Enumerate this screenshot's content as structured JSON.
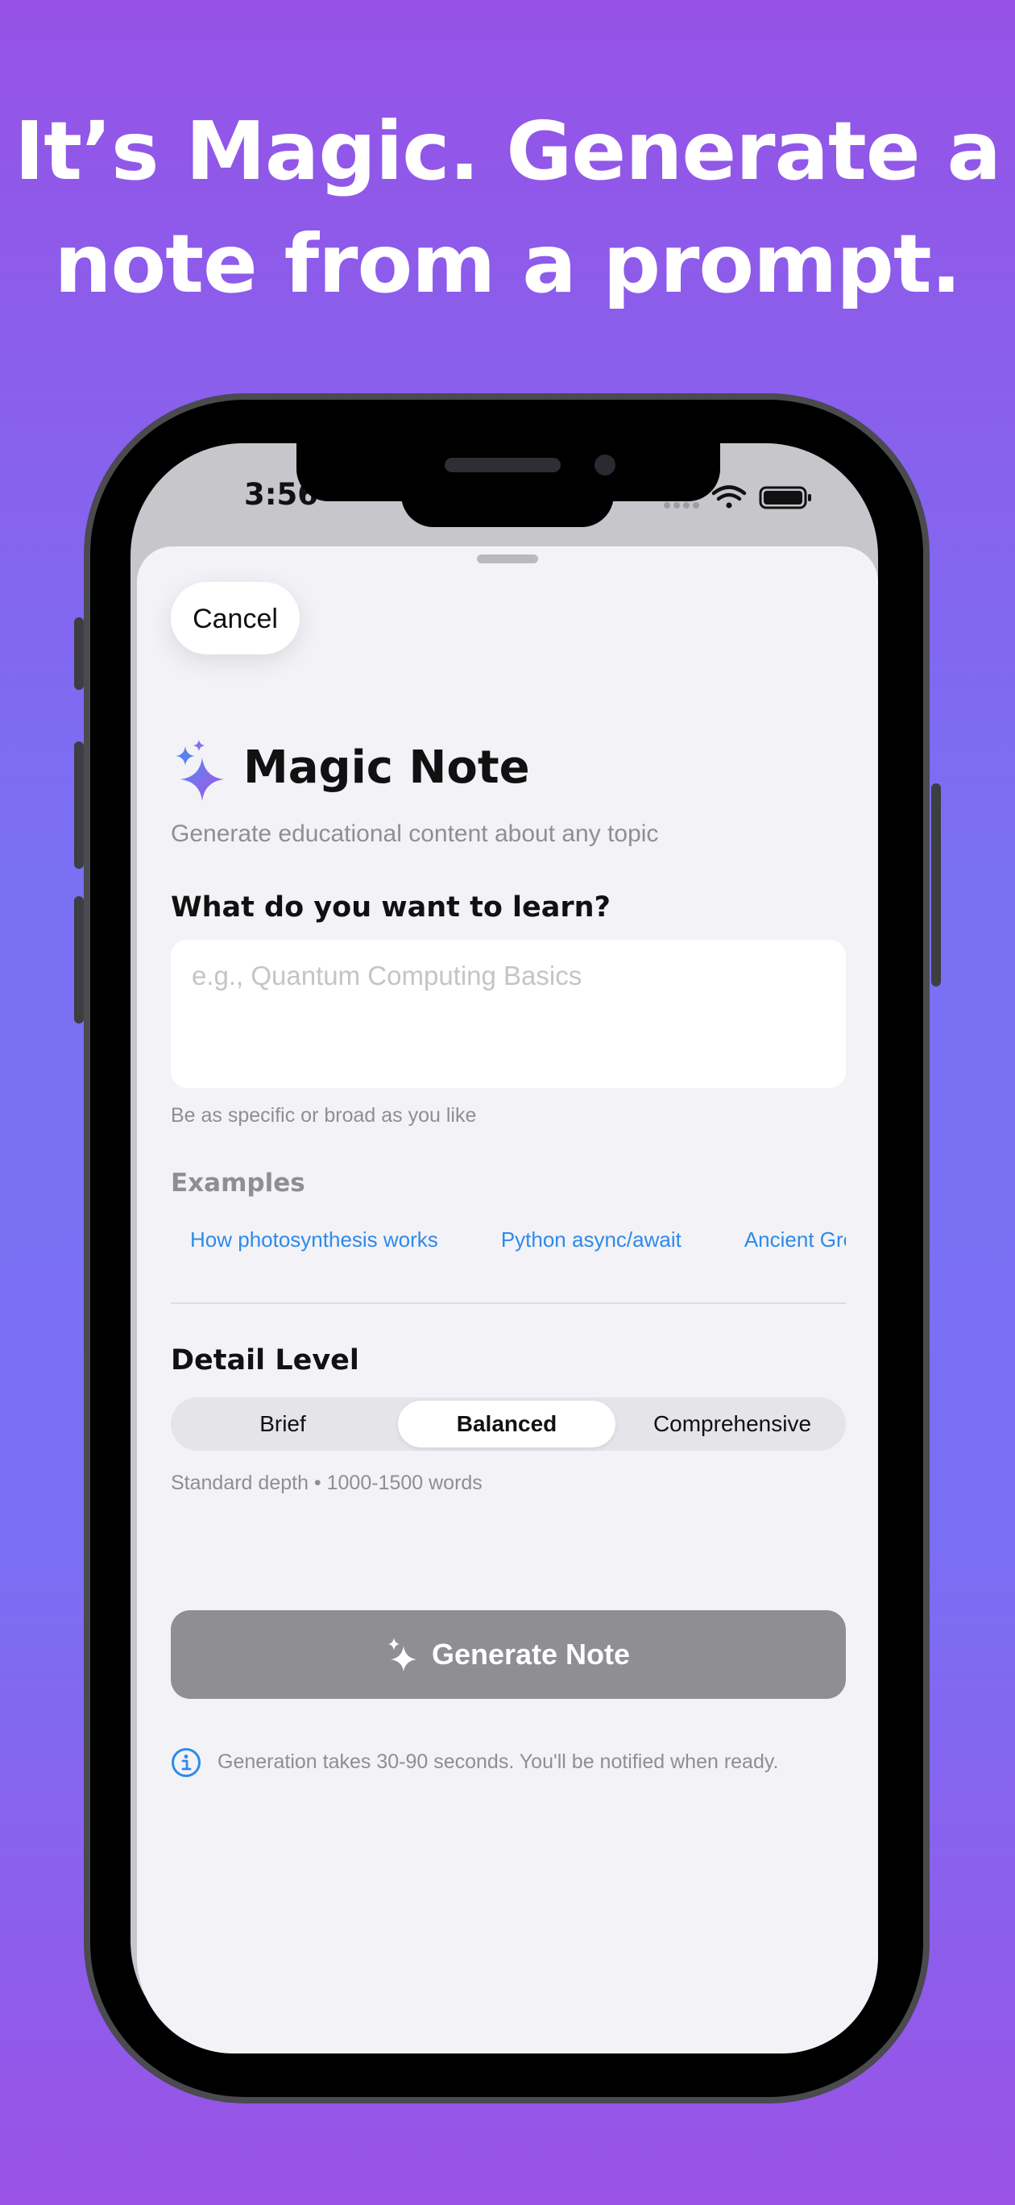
{
  "headline": {
    "line1": "It’s Magic. Generate a",
    "line2": "note from a prompt."
  },
  "status_bar": {
    "time": "3:56",
    "icons": [
      "signal-icon",
      "wifi-icon",
      "battery-icon"
    ]
  },
  "sheet": {
    "cancel_label": "Cancel",
    "title": "Magic Note",
    "title_icon": "sparkles-icon",
    "subtitle": "Generate educational content about any topic",
    "question": "What do you want to learn?",
    "topic_input": {
      "value": "",
      "placeholder": "e.g., Quantum Computing Basics"
    },
    "hint": "Be as specific or broad as you like",
    "examples_label": "Examples",
    "examples": [
      "How photosynthesis works",
      "Python async/await",
      "Ancient Gre"
    ],
    "detail_level": {
      "label": "Detail Level",
      "options": [
        "Brief",
        "Balanced",
        "Comprehensive"
      ],
      "selected": "Balanced",
      "description": "Standard depth • 1000-1500 words"
    },
    "generate_label": "Generate Note",
    "info_text": "Generation takes 30-90 seconds. You'll be notified when ready."
  },
  "colors": {
    "background_top": "#9652e6",
    "background_mid": "#7a70f4",
    "accent_link": "#2f8ae8",
    "button_disabled": "#8e8e93",
    "sheet_background": "#f2f2f7"
  }
}
